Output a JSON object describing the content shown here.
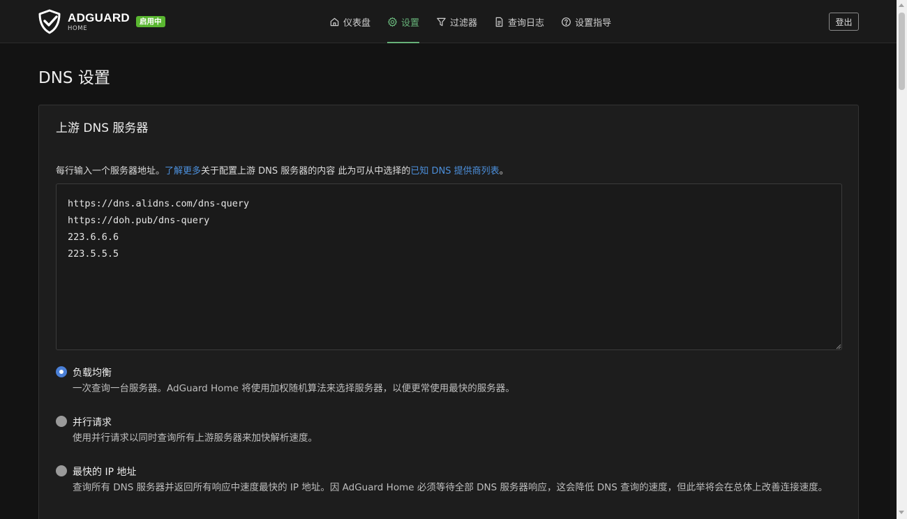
{
  "header": {
    "logo_title": "ADGUARD",
    "logo_subtitle": "HOME",
    "status_badge": "启用中",
    "nav": [
      {
        "label": "仪表盘",
        "icon": "home-icon",
        "active": false
      },
      {
        "label": "设置",
        "icon": "gear-icon",
        "active": true
      },
      {
        "label": "过滤器",
        "icon": "filter-icon",
        "active": false
      },
      {
        "label": "查询日志",
        "icon": "document-icon",
        "active": false
      },
      {
        "label": "设置指导",
        "icon": "help-icon",
        "active": false
      }
    ],
    "logout_label": "登出"
  },
  "page": {
    "title": "DNS 设置"
  },
  "upstream_card": {
    "title": "上游 DNS 服务器",
    "hint_prefix": "每行输入一个服务器地址。",
    "hint_link1": "了解更多",
    "hint_middle": "关于配置上游 DNS 服务器的内容 此为可从中选择的",
    "hint_link2": "已知 DNS 提供商列表",
    "hint_suffix": "。",
    "servers_text": "https://dns.alidns.com/dns-query\nhttps://doh.pub/dns-query\n223.6.6.6\n223.5.5.5",
    "modes": [
      {
        "label": "负载均衡",
        "description": "一次查询一台服务器。AdGuard Home 将使用加权随机算法来选择服务器，以便更常使用最快的服务器。",
        "checked": true
      },
      {
        "label": "并行请求",
        "description": "使用并行请求以同时查询所有上游服务器来加快解析速度。",
        "checked": false
      },
      {
        "label": "最快的 IP 地址",
        "description": "查询所有 DNS 服务器并返回所有响应中速度最快的 IP 地址。因 AdGuard Home 必须等待全部 DNS 服务器响应，这会降低 DNS 查询的速度，但此举将会在总体上改善连接速度。",
        "checked": false
      }
    ]
  },
  "colors": {
    "accent_green": "#67b279",
    "badge_green": "#5ab731",
    "link_blue": "#4c8fdb",
    "radio_blue": "#4a7fd6"
  }
}
